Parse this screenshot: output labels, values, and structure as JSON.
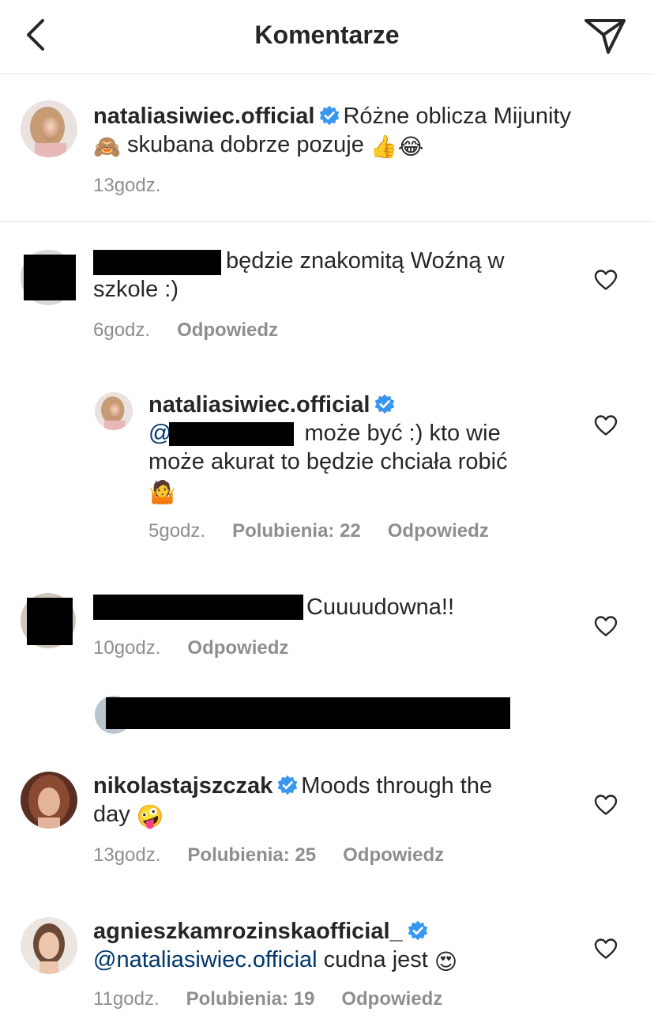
{
  "header": {
    "title": "Komentarze"
  },
  "caption": {
    "username": "nataliasiwiec.official",
    "text_line1": "Różne oblicza Mijunity",
    "emoji_monkey": "🙈",
    "text_line2": "skubana dobrze pozuje",
    "emoji_end": "👍😂",
    "time": "13godz."
  },
  "comments": [
    {
      "text_line1": "będzie znakomitą Woźną w",
      "text_line2": "szkole :)",
      "time": "6godz.",
      "reply": "Odpowiedz"
    },
    {
      "username": "nataliasiwiec.official",
      "at": "@",
      "text_line1": "może być :) kto wie",
      "text_line2": "może akurat to będzie chciała robić",
      "emoji": "🤷",
      "time": "5godz.",
      "likes": "Polubienia: 22",
      "reply": "Odpowiedz"
    },
    {
      "text": "Cuuuudowna!!",
      "time": "10godz.",
      "reply": "Odpowiedz"
    },
    {
      "username": "nikolastajszczak",
      "text_line1": "Moods through the",
      "text_line2": "day",
      "emoji": "🤪",
      "time": "13godz.",
      "likes": "Polubienia: 25",
      "reply": "Odpowiedz"
    },
    {
      "username": "agnieszkamrozinskaofficial_",
      "mention": "@nataliasiwiec.official",
      "text": "cudna jest",
      "emoji": "😍",
      "time": "11godz.",
      "likes": "Polubienia: 19",
      "reply": "Odpowiedz"
    }
  ],
  "colors": {
    "verified": "#3897f0",
    "meta": "#8e8e8e",
    "mention": "#00376b",
    "text": "#262626"
  },
  "icons": [
    "back-chevron-icon",
    "direct-send-icon",
    "verified-badge-icon",
    "heart-outline-icon"
  ]
}
